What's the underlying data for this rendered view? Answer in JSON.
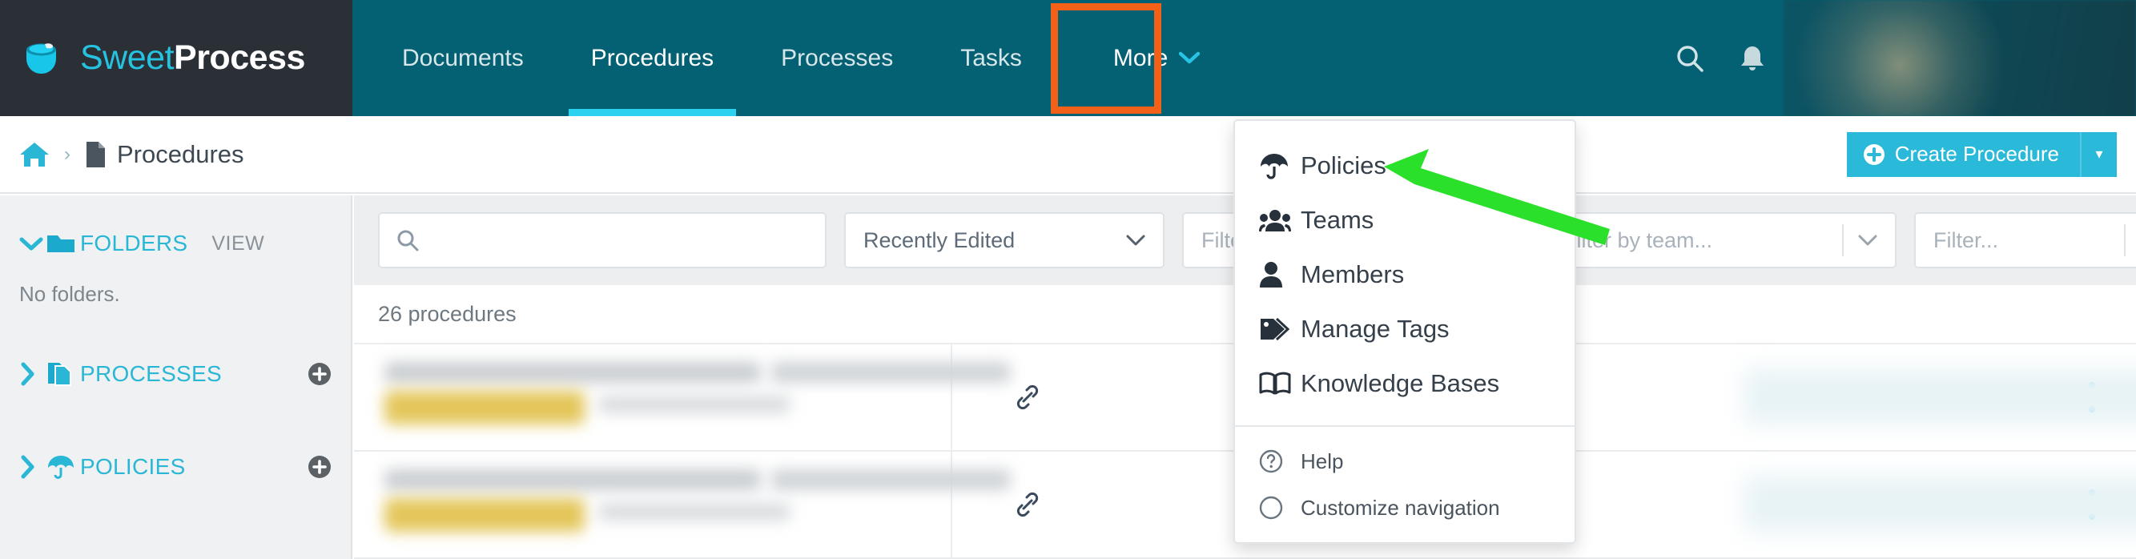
{
  "brand": {
    "part1": "Sweet",
    "part2": "Process",
    "logo_icon": "coffee-cup-icon"
  },
  "topnav": {
    "links": [
      {
        "label": "Documents",
        "active": false
      },
      {
        "label": "Procedures",
        "active": true
      },
      {
        "label": "Processes",
        "active": false
      },
      {
        "label": "Tasks",
        "active": false
      }
    ],
    "more": {
      "label": "More",
      "caret": "⌄",
      "highlight_color": "#f26117"
    },
    "icons": [
      {
        "name": "search-icon"
      },
      {
        "name": "bell-icon"
      }
    ],
    "bg_color": "#046073",
    "brand_bg_color": "#2b3036",
    "active_underline_color": "#2ad2f0"
  },
  "more_menu": {
    "items": [
      {
        "label": "Policies",
        "icon": "umbrella-icon"
      },
      {
        "label": "Teams",
        "icon": "users-icon"
      },
      {
        "label": "Members",
        "icon": "user-icon"
      },
      {
        "label": "Manage Tags",
        "icon": "tag-icon"
      },
      {
        "label": "Knowledge Bases",
        "icon": "book-open-icon"
      }
    ],
    "secondary": [
      {
        "label": "Help",
        "icon": "question-circle-icon"
      },
      {
        "label": "Customize navigation",
        "icon": "compass-icon"
      }
    ]
  },
  "breadcrumb": {
    "home_icon": "home-icon",
    "separator": "›",
    "page_icon": "document-icon",
    "title": "Procedures"
  },
  "create_button": {
    "label": "Create Procedure",
    "plus_icon": "plus-circle-icon",
    "dropdown_caret": "▾",
    "color": "#2ab9d9"
  },
  "sidebar": {
    "sections": [
      {
        "label": "FOLDERS",
        "icon": "folder-icon",
        "chevron": "⌄",
        "expanded": true,
        "action": "VIEW",
        "empty_text": "No folders."
      },
      {
        "label": "PROCESSES",
        "icon": "copy-documents-icon",
        "chevron": "›",
        "expanded": false,
        "action_icon": "plus-circle-icon"
      },
      {
        "label": "POLICIES",
        "icon": "umbrella-icon",
        "chevron": "›",
        "expanded": false,
        "action_icon": "plus-circle-icon"
      }
    ],
    "accent_color": "#2ab7d6"
  },
  "toolbar": {
    "search_placeholder": "",
    "search_value": "",
    "search_icon": "search-icon",
    "sort_select": {
      "value": "Recently Edited",
      "caret": "⌄"
    },
    "filter_select_1": {
      "value": "Filter...",
      "caret": "⌄"
    },
    "team_select": {
      "value": "Filter by team...",
      "caret": "⌄"
    },
    "filter_select_2": {
      "value": "Filter...",
      "caret": "⌄"
    }
  },
  "list": {
    "count_text": "26 procedures",
    "rows": [
      {
        "link_icon": "link-icon",
        "menu_icon": "kebab-menu-icon"
      },
      {
        "link_icon": "link-icon",
        "menu_icon": "kebab-menu-icon"
      }
    ]
  },
  "annotation": {
    "arrow_color": "#2ae02a",
    "highlight_box_color": "#f26117"
  }
}
